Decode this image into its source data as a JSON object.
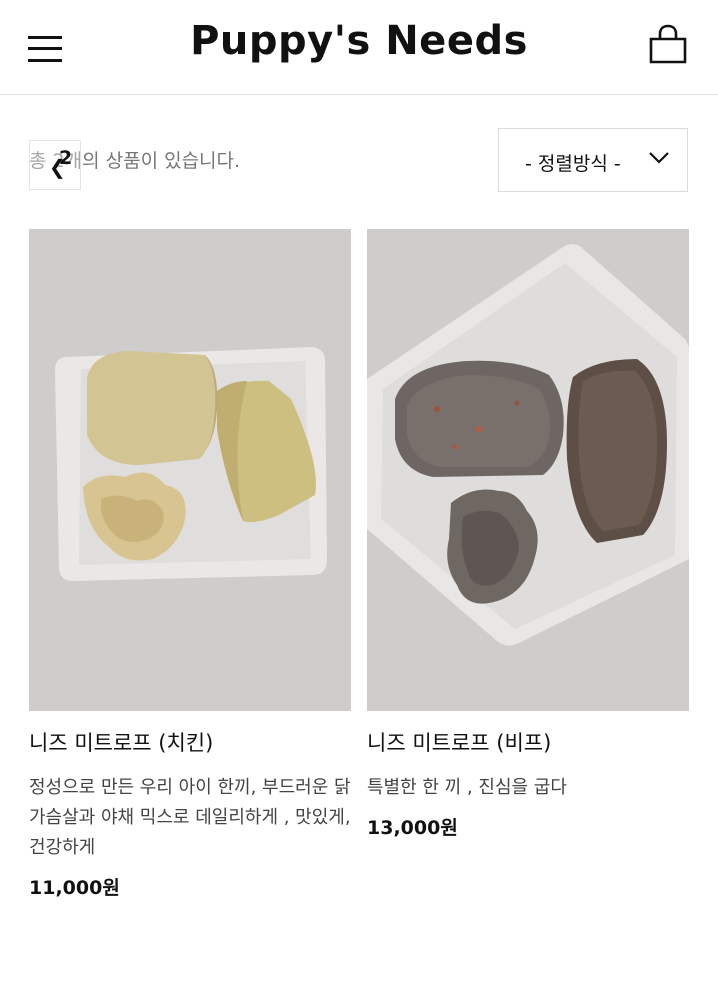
{
  "header": {
    "brand": "Puppy's Needs"
  },
  "toolbar": {
    "count_text": "총 2개의 상품이 있습니다.",
    "back_number": "2",
    "sort_label": "- 정렬방식 -"
  },
  "products": [
    {
      "name": "니즈 미트로프 (치킨)",
      "description": "정성으로 만든 우리 아이 한끼, 부드러운 닭가슴살과 야채 믹스로 데일리하게 , 맛있게, 건강하게",
      "price": "11,000원",
      "image_icon": "chicken-meatloaf-photo"
    },
    {
      "name": "니즈 미트로프 (비프)",
      "description": "특별한 한 끼 , 진심을 굽다",
      "price": "13,000원",
      "image_icon": "beef-meatloaf-photo"
    }
  ],
  "colors": {
    "text": "#111111",
    "muted": "#777777",
    "border": "#e2e2e2",
    "photo_bg": "#cfcdcb"
  }
}
